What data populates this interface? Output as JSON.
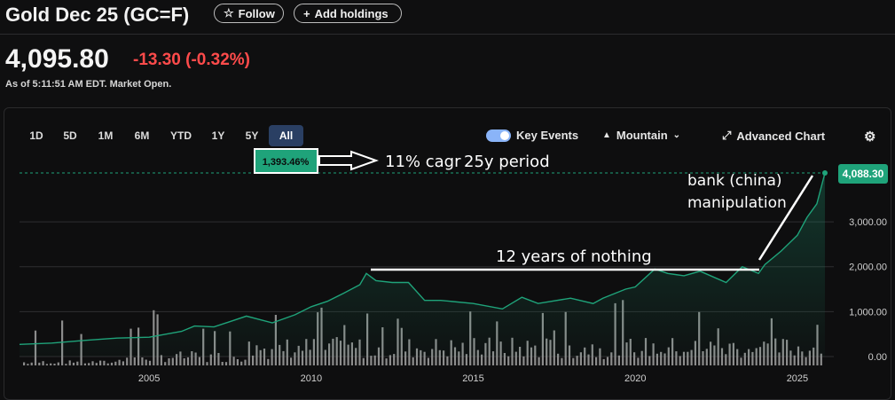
{
  "header": {
    "title": "Gold Dec 25 (GC=F)",
    "follow_label": "Follow",
    "add_holdings_label": "Add holdings"
  },
  "quote": {
    "price": "4,095.80",
    "change": "-13.30",
    "change_pct": "(-0.32%)",
    "as_of": "As of 5:11:51 AM EDT. Market Open."
  },
  "ranges": [
    "1D",
    "5D",
    "1M",
    "6M",
    "YTD",
    "1Y",
    "5Y",
    "All"
  ],
  "active_range": "All",
  "controls": {
    "key_events_label": "Key Events",
    "key_events_on": true,
    "chart_type_label": "Mountain",
    "advanced_chart_label": "Advanced Chart"
  },
  "colors": {
    "line": "#1fa37a",
    "negative": "#ff4b4b",
    "badge": "#1fa37a"
  },
  "chart_data": {
    "type": "area",
    "xlabel": "",
    "ylabel": "",
    "x_ticks": [
      "2005",
      "2010",
      "2015",
      "2020",
      "2025"
    ],
    "y_ticks": [
      "0.00",
      "1,000.00",
      "2,000.00",
      "3,000.00"
    ],
    "ylim": [
      0,
      4300
    ],
    "xlim": [
      2001.0,
      2025.85
    ],
    "last_value_label": "4,088.30",
    "period_change_label": "1,393.46%",
    "series": [
      {
        "x": [
          2001.0,
          2002.0,
          2003.0,
          2004.0,
          2005.0,
          2006.0,
          2006.4,
          2007.0,
          2008.0,
          2008.8,
          2009.5,
          2010.0,
          2010.5,
          2011.0,
          2011.5,
          2011.7,
          2012.0,
          2012.5,
          2013.0,
          2013.5,
          2014.0,
          2015.0,
          2015.9,
          2016.5,
          2017.0,
          2018.0,
          2018.7,
          2019.0,
          2019.7,
          2020.0,
          2020.6,
          2021.0,
          2021.5,
          2022.0,
          2022.8,
          2023.3,
          2023.8,
          2024.0,
          2024.5,
          2025.0,
          2025.3,
          2025.6,
          2025.85
        ],
        "values": [
          270,
          300,
          360,
          410,
          430,
          560,
          680,
          660,
          900,
          750,
          930,
          1110,
          1230,
          1410,
          1600,
          1850,
          1690,
          1650,
          1650,
          1250,
          1250,
          1180,
          1060,
          1320,
          1180,
          1300,
          1180,
          1300,
          1500,
          1550,
          1950,
          1850,
          1800,
          1900,
          1650,
          2000,
          1850,
          2050,
          2350,
          2700,
          3100,
          3400,
          4088
        ]
      }
    ],
    "annotations": [
      "11% cagr",
      "25y period",
      "bank (china)",
      "manipulation",
      "12 years of nothing"
    ]
  }
}
